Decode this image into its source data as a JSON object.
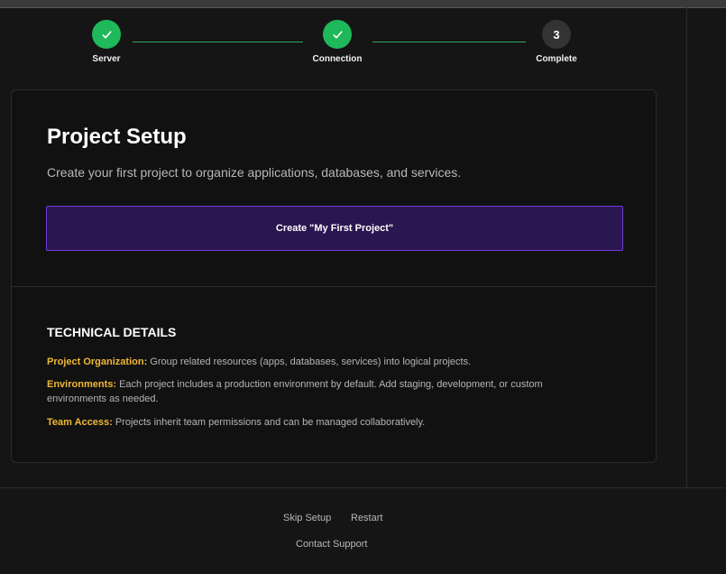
{
  "stepper": {
    "steps": [
      {
        "label": "Server",
        "status": "done",
        "icon": "check-icon"
      },
      {
        "label": "Connection",
        "status": "done",
        "icon": "check-icon"
      },
      {
        "label": "Complete",
        "status": "current",
        "number": "3"
      }
    ],
    "colors": {
      "done": "#1fb85a",
      "current": "#333333",
      "line": "#2fa863"
    }
  },
  "card": {
    "title": "Project Setup",
    "subtitle": "Create your first project to organize applications, databases, and services.",
    "create_button_label": "Create \"My First Project\"",
    "technical": {
      "title": "TECHNICAL DETAILS",
      "items": [
        {
          "key": "Project Organization:",
          "text": " Group related resources (apps, databases, services) into logical projects."
        },
        {
          "key": "Environments:",
          "text": " Each project includes a production environment by default. Add staging, development, or custom environments as needed."
        },
        {
          "key": "Team Access:",
          "text": " Projects inherit team permissions and can be managed collaboratively."
        }
      ]
    },
    "colors": {
      "button_bg": "#2a1650",
      "button_border": "#6f3bd6",
      "key_highlight": "#f0b834"
    }
  },
  "footer": {
    "skip_label": "Skip Setup",
    "restart_label": "Restart",
    "support_label": "Contact Support"
  }
}
